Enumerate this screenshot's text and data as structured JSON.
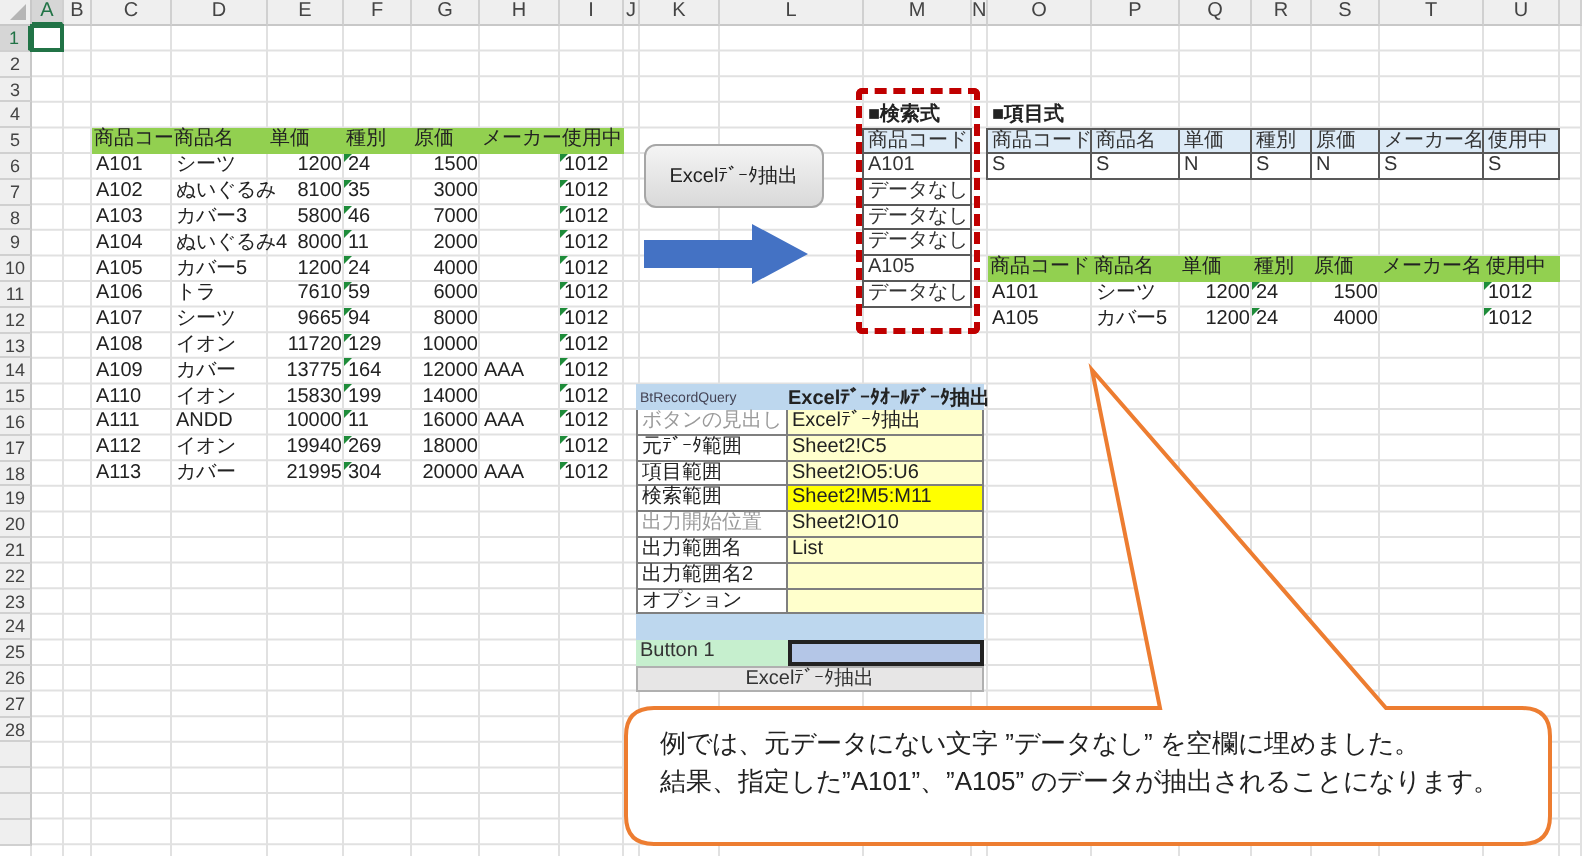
{
  "column_headers": [
    {
      "label": "A",
      "selected": true
    },
    {
      "label": "B",
      "selected": false
    },
    {
      "label": "C",
      "selected": false
    },
    {
      "label": "D",
      "selected": false
    },
    {
      "label": "E",
      "selected": false
    },
    {
      "label": "F",
      "selected": false
    },
    {
      "label": "G",
      "selected": false
    },
    {
      "label": "H",
      "selected": false
    },
    {
      "label": "I",
      "selected": false
    },
    {
      "label": "J",
      "selected": false
    },
    {
      "label": "K",
      "selected": false
    },
    {
      "label": "L",
      "selected": false
    },
    {
      "label": "M",
      "selected": false
    },
    {
      "label": "N",
      "selected": false
    },
    {
      "label": "O",
      "selected": false
    },
    {
      "label": "P",
      "selected": false
    },
    {
      "label": "Q",
      "selected": false
    },
    {
      "label": "R",
      "selected": false
    },
    {
      "label": "S",
      "selected": false
    },
    {
      "label": "T",
      "selected": false
    },
    {
      "label": "U",
      "selected": false
    }
  ],
  "row_headers": [
    {
      "label": "1",
      "selected": true
    },
    {
      "label": "2",
      "selected": false
    },
    {
      "label": "3",
      "selected": false
    },
    {
      "label": "4",
      "selected": false
    },
    {
      "label": "5",
      "selected": false
    },
    {
      "label": "6",
      "selected": false
    },
    {
      "label": "7",
      "selected": false
    },
    {
      "label": "8",
      "selected": false
    },
    {
      "label": "9",
      "selected": false
    },
    {
      "label": "10",
      "selected": false
    },
    {
      "label": "11",
      "selected": false
    },
    {
      "label": "12",
      "selected": false
    },
    {
      "label": "13",
      "selected": false
    },
    {
      "label": "14",
      "selected": false
    },
    {
      "label": "15",
      "selected": false
    },
    {
      "label": "16",
      "selected": false
    },
    {
      "label": "17",
      "selected": false
    },
    {
      "label": "18",
      "selected": false
    },
    {
      "label": "19",
      "selected": false
    },
    {
      "label": "20",
      "selected": false
    },
    {
      "label": "21",
      "selected": false
    },
    {
      "label": "22",
      "selected": false
    },
    {
      "label": "23",
      "selected": false
    },
    {
      "label": "24",
      "selected": false
    },
    {
      "label": "25",
      "selected": false
    },
    {
      "label": "26",
      "selected": false
    },
    {
      "label": "27",
      "selected": false
    },
    {
      "label": "28",
      "selected": false
    }
  ],
  "source_table": {
    "columns": [
      {
        "label": "商品コー",
        "kind": "text"
      },
      {
        "label": "商品名",
        "kind": "text"
      },
      {
        "label": "単価",
        "kind": "number"
      },
      {
        "label": "種別",
        "kind": "flagged"
      },
      {
        "label": "原価",
        "kind": "number"
      },
      {
        "label": "メーカー",
        "kind": "text"
      },
      {
        "label": "使用中",
        "kind": "flagged"
      }
    ],
    "rows": [
      [
        "A101",
        "シーツ",
        "1200",
        "24",
        "1500",
        null,
        "1012"
      ],
      [
        "A102",
        "ぬいぐるみ",
        "8100",
        "35",
        "3000",
        null,
        "1012"
      ],
      [
        "A103",
        "カバー3",
        "5800",
        "46",
        "7000",
        null,
        "1012"
      ],
      [
        "A104",
        "ぬいぐるみ4",
        "8000",
        "11",
        "2000",
        null,
        "1012"
      ],
      [
        "A105",
        "カバー5",
        "1200",
        "24",
        "4000",
        null,
        "1012"
      ],
      [
        "A106",
        "トラ",
        "7610",
        "59",
        "6000",
        null,
        "1012"
      ],
      [
        "A107",
        "シーツ",
        "9665",
        "94",
        "8000",
        null,
        "1012"
      ],
      [
        "A108",
        "イオン",
        "11720",
        "129",
        "10000",
        null,
        "1012"
      ],
      [
        "A109",
        "カバー",
        "13775",
        "164",
        "12000",
        "AAA",
        "1012"
      ],
      [
        "A110",
        "イオン",
        "15830",
        "199",
        "14000",
        null,
        "1012"
      ],
      [
        "A111",
        "ANDD",
        "10000",
        "11",
        "16000",
        "AAA",
        "1012"
      ],
      [
        "A112",
        "イオン",
        "19940",
        "269",
        "18000",
        null,
        "1012"
      ],
      [
        "A113",
        "カバー",
        "21995",
        "304",
        "20000",
        "AAA",
        "1012"
      ]
    ]
  },
  "extract_button": {
    "label": "Excelﾃﾞｰﾀ抽出"
  },
  "search_criteria": {
    "title": "■検索式",
    "header": "商品コード",
    "values": [
      "A101",
      "データなし",
      "データなし",
      "データなし",
      "A105",
      "データなし"
    ]
  },
  "field_types": {
    "title": "■項目式",
    "columns": [
      "商品コード",
      "商品名",
      "単価",
      "種別",
      "原価",
      "メーカー名",
      "使用中"
    ],
    "values": [
      "S",
      "S",
      "N",
      "S",
      "N",
      "S",
      "S"
    ]
  },
  "result_table": {
    "columns": [
      "商品コード",
      "商品名",
      "単価",
      "種別",
      "原価",
      "メーカー名",
      "使用中"
    ],
    "rows": [
      [
        "A101",
        "シーツ",
        "1200",
        "24",
        "1500",
        null,
        "1012"
      ],
      [
        "A105",
        "カバー5",
        "1200",
        "24",
        "4000",
        null,
        "1012"
      ]
    ]
  },
  "settings_panel": {
    "header": [
      "BtRecordQuery",
      "Excelﾃﾞｰﾀｵｰﾙﾃﾞｰﾀ抽出"
    ],
    "rows": [
      {
        "label": "ボタンの見出し",
        "value": "Excelﾃﾞｰﾀ抽出",
        "muted": true,
        "highlighted": false
      },
      {
        "label": "元ﾃﾞｰﾀ範囲",
        "value": "Sheet2!C5",
        "muted": false,
        "highlighted": false
      },
      {
        "label": "項目範囲",
        "value": "Sheet2!O5:U6",
        "muted": false,
        "highlighted": false
      },
      {
        "label": "検索範囲",
        "value": "Sheet2!M5:M11",
        "muted": false,
        "highlighted": true
      },
      {
        "label": "出力開始位置",
        "value": "Sheet2!O10",
        "muted": true,
        "highlighted": false
      },
      {
        "label": "出力範囲名",
        "value": "List",
        "muted": false,
        "highlighted": false
      },
      {
        "label": "出力範囲名2",
        "muted": false,
        "highlighted": false
      },
      {
        "label": "オプション",
        "muted": false,
        "highlighted": false
      }
    ],
    "button_name": "Button 1",
    "run_button": "Excelﾃﾞｰﾀ抽出"
  },
  "callout": {
    "lines": [
      "例では、元データにない文字 ”データなし” を空欄に埋めました。",
      "結果、指定した”A101”、”A105” のデータが抽出されることになります。"
    ]
  }
}
